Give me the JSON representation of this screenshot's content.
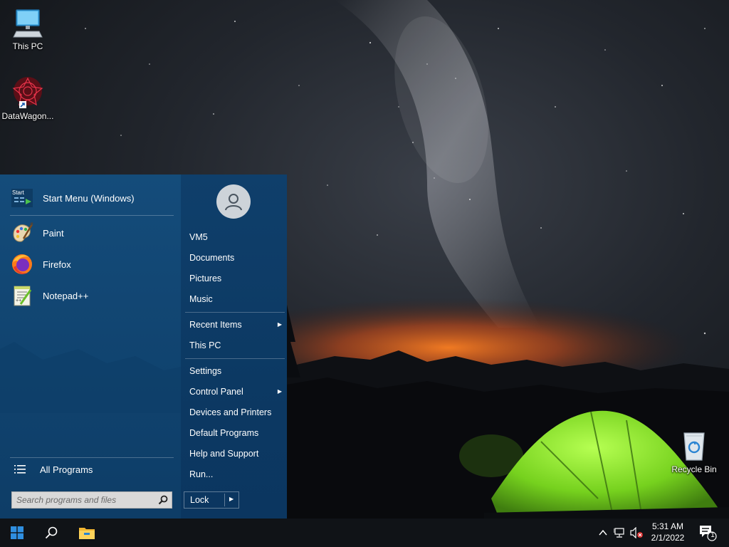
{
  "desktop": {
    "icons": [
      {
        "label": "This PC",
        "icon": "computer-icon"
      },
      {
        "label": "DataWagon...",
        "icon": "datawagon-icon"
      },
      {
        "label": "Recycle Bin",
        "icon": "recycle-bin-icon"
      }
    ]
  },
  "start_menu": {
    "pinned": [
      {
        "label": "Start Menu (Windows)",
        "icon": "start-menu-settings-icon",
        "icon_text": "Start"
      },
      {
        "label": "Paint",
        "icon": "paint-icon"
      },
      {
        "label": "Firefox",
        "icon": "firefox-icon"
      },
      {
        "label": "Notepad++",
        "icon": "notepad-plus-plus-icon"
      }
    ],
    "all_programs": "All Programs",
    "search": {
      "placeholder": "Search programs and files",
      "value": ""
    },
    "right": {
      "items": [
        {
          "label": "VM5"
        },
        {
          "label": "Documents"
        },
        {
          "label": "Pictures"
        },
        {
          "label": "Music"
        },
        {
          "label": "Recent Items",
          "submenu": true
        },
        {
          "label": "This PC"
        },
        {
          "label": "Settings"
        },
        {
          "label": "Control Panel",
          "submenu": true
        },
        {
          "label": "Devices and Printers"
        },
        {
          "label": "Default Programs"
        },
        {
          "label": "Help and Support"
        },
        {
          "label": "Run..."
        }
      ],
      "lock_label": "Lock"
    }
  },
  "taskbar": {
    "clock_time": "5:31 AM",
    "clock_date": "2/1/2022",
    "notification_count": "1",
    "icons": [
      "windows-start-icon",
      "search-icon",
      "file-explorer-icon"
    ]
  },
  "colors": {
    "start_menu_bg": "#0f3f6b",
    "taskbar_bg": "#101317",
    "tent_green": "#7ee02a",
    "horizon_orange": "#e8621a"
  }
}
